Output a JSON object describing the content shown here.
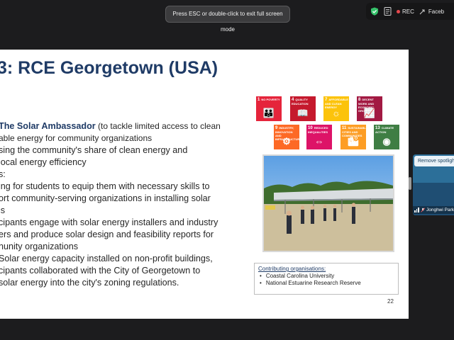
{
  "banner": {
    "text": "Press ESC or double-click to exit full screen mode"
  },
  "topbar": {
    "rec_label": "REC",
    "tab_label": "Faceb",
    "colors": {
      "shield": "#36c26b",
      "rec_dot": "#e5484d"
    },
    "icons": [
      "shield-check-icon",
      "document-icon",
      "record-dot-icon",
      "share-icon"
    ]
  },
  "slide": {
    "title": "3: RCE Georgetown (USA)",
    "lines": {
      "l1_bold": "The Solar Ambassador",
      "l1_rest": " (to tackle limited access to clean",
      "l2": "able energy for community organizations",
      "l3": "sing the community's share of clean energy and",
      "l4": " local energy efficiency",
      "l5": "s:",
      "l6": "ing for students to equip them with necessary skills to",
      "l7": "ort community-serving organizations in installing solar",
      "l8": "ls",
      "l9": "cipants engage with solar energy installers and industry",
      "l10": "ers and produce solar design and feasibility reports for",
      "l11": "nunity organizations",
      "l12": " Solar energy capacity installed on non-profit buildings,",
      "l13": "cipants collaborated with the City of Georgetown to",
      "l14": "solar energy into the city's zoning regulations."
    },
    "sdgs": [
      {
        "num": "1",
        "label": "NO POVERTY",
        "color": "#e5243b",
        "glyph": "👪"
      },
      {
        "num": "4",
        "label": "QUALITY EDUCATION",
        "color": "#c5192d",
        "glyph": "📖"
      },
      {
        "num": "7",
        "label": "AFFORDABLE AND CLEAN ENERGY",
        "color": "#fcc30b",
        "glyph": "☼"
      },
      {
        "num": "8",
        "label": "DECENT WORK AND ECONOMIC GROWTH",
        "color": "#a21942",
        "glyph": "📈"
      },
      {
        "num": "9",
        "label": "INDUSTRY, INNOVATION AND INFRASTRUCTURE",
        "color": "#fd6925",
        "glyph": "⚙"
      },
      {
        "num": "10",
        "label": "REDUCED INEQUALITIES",
        "color": "#dd1367",
        "glyph": "⇔"
      },
      {
        "num": "11",
        "label": "SUSTAINABLE CITIES AND COMMUNITIES",
        "color": "#fd9d24",
        "glyph": "🏙"
      },
      {
        "num": "13",
        "label": "CLIMATE ACTION",
        "color": "#3f7e44",
        "glyph": "◉"
      }
    ],
    "contributing": {
      "title": "Contributing organisations:",
      "items": [
        "Coastal Carolina University",
        "National Estuarine Research Reserve"
      ]
    },
    "page_number": "22"
  },
  "video_tile": {
    "spotlight_button": "Remove spotlight",
    "participant_name": "Jonghwi Park"
  }
}
